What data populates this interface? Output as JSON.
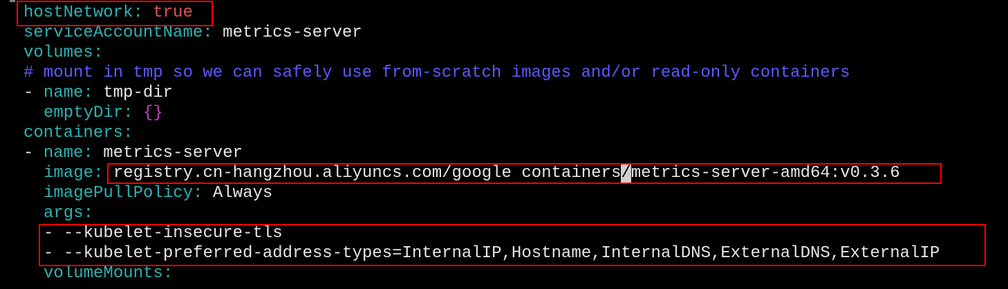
{
  "terminal": {
    "lines": [
      {
        "k": "hostNetwork",
        "sep": ": ",
        "v": "true"
      },
      {
        "k": "serviceAccountName",
        "sep": ": ",
        "v": "metrics-server"
      },
      {
        "k": "volumes",
        "sep": ":"
      },
      {
        "c": "# mount in tmp so we can safely use from-scratch images and/or read-only containers"
      },
      {
        "d": "- ",
        "k": "name",
        "sep": ": ",
        "v": "tmp-dir"
      },
      {
        "k": "emptyDir",
        "sep": ": ",
        "v": "{}"
      },
      {
        "k": "containers",
        "sep": ":"
      },
      {
        "d": "- ",
        "k": "name",
        "sep": ": ",
        "v": "metrics-server"
      },
      {
        "k": "image",
        "sep": ": ",
        "v1": "registry.cn-hangzhou.aliyuncs.com/google containers",
        "cur": "/",
        "v2": "metrics-server-amd64:v0.3.6"
      },
      {
        "k": "imagePullPolicy",
        "sep": ": ",
        "v": "Always"
      },
      {
        "k": "args",
        "sep": ":"
      },
      {
        "d": "- ",
        "v": "--kubelet-insecure-tls"
      },
      {
        "d": "- ",
        "v": "--kubelet-preferred-address-types=InternalIP,Hostname,InternalDNS,ExternalDNS,ExternalIP"
      },
      {
        "k": "volumeMounts",
        "sep": ":"
      }
    ]
  },
  "colors": {
    "key": "#2ab3b3",
    "value": "#e6e6e6",
    "boolean": "#e05555",
    "comment": "#5a5aff",
    "brace": "#c040c0",
    "highlight_box": "#ff0000"
  }
}
